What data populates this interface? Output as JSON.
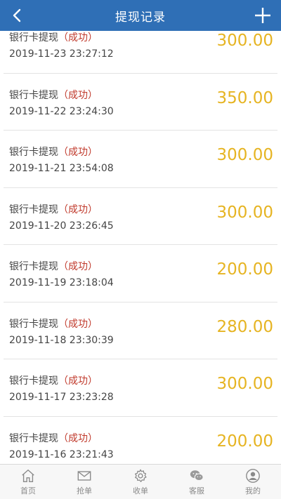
{
  "header": {
    "title": "提现记录"
  },
  "records": [
    {
      "type": "银行卡提现",
      "status": "（成功）",
      "time": "2019-11-23 23:27:12",
      "amount": "300.00"
    },
    {
      "type": "银行卡提现",
      "status": "（成功）",
      "time": "2019-11-22 23:24:30",
      "amount": "350.00"
    },
    {
      "type": "银行卡提现",
      "status": "（成功）",
      "time": "2019-11-21 23:54:08",
      "amount": "300.00"
    },
    {
      "type": "银行卡提现",
      "status": "（成功）",
      "time": "2019-11-20 23:26:45",
      "amount": "300.00"
    },
    {
      "type": "银行卡提现",
      "status": "（成功）",
      "time": "2019-11-19 23:18:04",
      "amount": "200.00"
    },
    {
      "type": "银行卡提现",
      "status": "（成功）",
      "time": "2019-11-18 23:30:39",
      "amount": "280.00"
    },
    {
      "type": "银行卡提现",
      "status": "（成功）",
      "time": "2019-11-17 23:23:28",
      "amount": "300.00"
    },
    {
      "type": "银行卡提现",
      "status": "（成功）",
      "time": "2019-11-16 23:21:43",
      "amount": "200.00"
    }
  ],
  "tabbar": [
    {
      "label": "首页",
      "icon": "home-icon"
    },
    {
      "label": "抢单",
      "icon": "mail-icon"
    },
    {
      "label": "收单",
      "icon": "gear-icon"
    },
    {
      "label": "客服",
      "icon": "chat-icon"
    },
    {
      "label": "我的",
      "icon": "user-icon"
    }
  ],
  "colors": {
    "header": "#2f6fb6",
    "amount": "#e6b422",
    "status": "#c0392b"
  }
}
